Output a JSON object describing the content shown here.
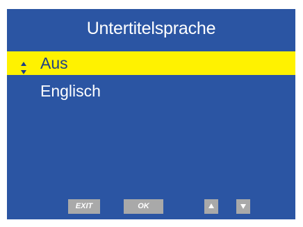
{
  "screen": {
    "title": "Untertitelsprache"
  },
  "menu": {
    "items": [
      {
        "label": "Aus",
        "selected": true
      },
      {
        "label": "Englisch",
        "selected": false
      }
    ]
  },
  "footer": {
    "exit_label": "EXIT",
    "ok_label": "OK",
    "up_icon": "up-arrow-icon",
    "down_icon": "down-arrow-icon"
  },
  "colors": {
    "background": "#2b55a3",
    "highlight": "#fff200",
    "button": "#a9a9a9"
  }
}
